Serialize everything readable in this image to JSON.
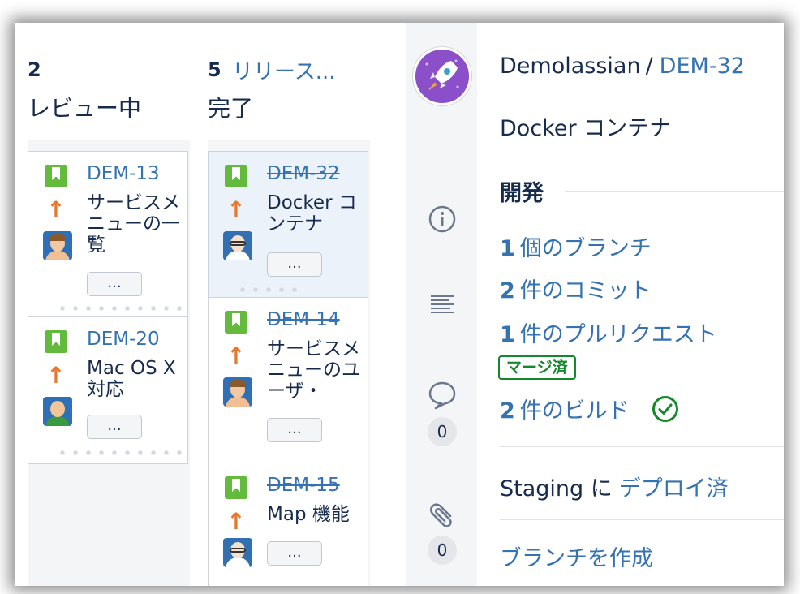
{
  "columns": [
    {
      "count": "2",
      "status": "レビュー中",
      "cards": [
        {
          "key": "DEM-13",
          "summary": "サービスメニューの一覧",
          "done": false,
          "avatar": "avatar"
        },
        {
          "key": "DEM-20",
          "summary": "Mac OS X 対応",
          "done": false,
          "avatar": "avatar"
        }
      ]
    },
    {
      "count": "5",
      "link": "リリース...",
      "status": "完了",
      "cards": [
        {
          "key": "DEM-32",
          "summary": "Docker コンテナ",
          "done": true,
          "selected": true,
          "avatar": "avatar"
        },
        {
          "key": "DEM-14",
          "summary": "サービスメニューのユーザ・",
          "done": true,
          "avatar": "avatar"
        },
        {
          "key": "DEM-15",
          "summary": "Map 機能",
          "done": true,
          "avatar": "avatar"
        }
      ]
    }
  ],
  "card_more_label": "...",
  "strip": {
    "comment_count": "0",
    "attachment_count": "0"
  },
  "detail": {
    "project": "Demolassian",
    "separator": "/",
    "issue_key": "DEM-32",
    "title": "Docker コンテナ",
    "development_heading": "開発",
    "branches": {
      "count": "1",
      "label": "個のブランチ"
    },
    "commits": {
      "count": "2",
      "label": "件のコミット"
    },
    "pull_requests": {
      "count": "1",
      "label": "件のプルリクエスト"
    },
    "merged_lozenge": "マージ済",
    "builds": {
      "count": "2",
      "label": "件のビルド"
    },
    "deploy_env": "Staging に",
    "deploy_link": "デプロイ済",
    "create_branch": "ブランチを作成"
  },
  "colors": {
    "link": "#3572b0",
    "story_green": "#63ba3c",
    "priority_orange": "#e8772e",
    "success_green": "#14892c",
    "panel_gray": "#f4f5f7"
  },
  "icons": {
    "issue_type": "story-bookmark-icon",
    "priority": "priority-high-arrow-icon",
    "info": "info-icon",
    "description": "text-lines-icon",
    "comment": "comment-bubble-icon",
    "attachment": "paperclip-icon",
    "build_status": "check-circle-icon",
    "project": "rocket-project-avatar"
  }
}
